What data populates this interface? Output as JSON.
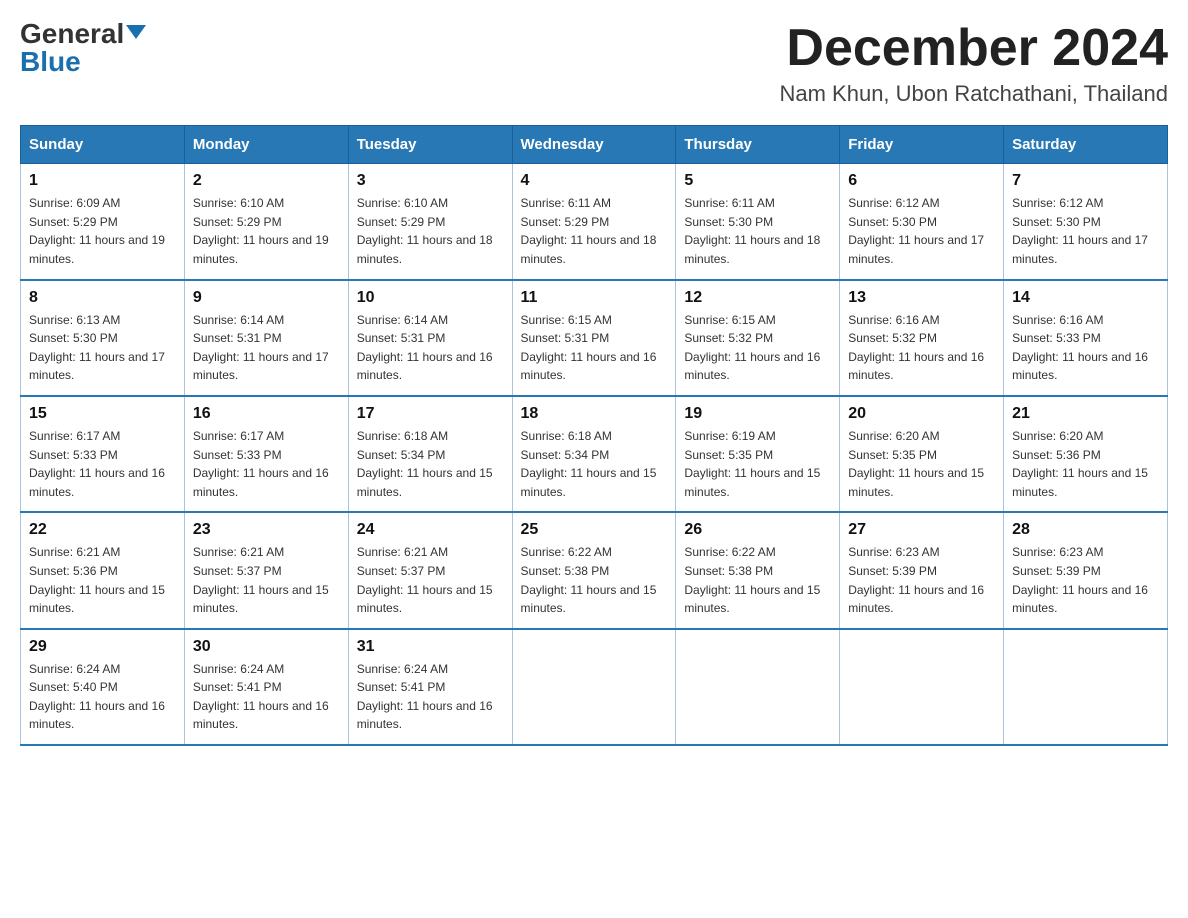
{
  "logo": {
    "general": "General",
    "blue": "Blue",
    "triangle": true
  },
  "title": "December 2024",
  "subtitle": "Nam Khun, Ubon Ratchathani, Thailand",
  "days_of_week": [
    "Sunday",
    "Monday",
    "Tuesday",
    "Wednesday",
    "Thursday",
    "Friday",
    "Saturday"
  ],
  "weeks": [
    [
      {
        "day": "1",
        "sunrise": "6:09 AM",
        "sunset": "5:29 PM",
        "daylight": "11 hours and 19 minutes."
      },
      {
        "day": "2",
        "sunrise": "6:10 AM",
        "sunset": "5:29 PM",
        "daylight": "11 hours and 19 minutes."
      },
      {
        "day": "3",
        "sunrise": "6:10 AM",
        "sunset": "5:29 PM",
        "daylight": "11 hours and 18 minutes."
      },
      {
        "day": "4",
        "sunrise": "6:11 AM",
        "sunset": "5:29 PM",
        "daylight": "11 hours and 18 minutes."
      },
      {
        "day": "5",
        "sunrise": "6:11 AM",
        "sunset": "5:30 PM",
        "daylight": "11 hours and 18 minutes."
      },
      {
        "day": "6",
        "sunrise": "6:12 AM",
        "sunset": "5:30 PM",
        "daylight": "11 hours and 17 minutes."
      },
      {
        "day": "7",
        "sunrise": "6:12 AM",
        "sunset": "5:30 PM",
        "daylight": "11 hours and 17 minutes."
      }
    ],
    [
      {
        "day": "8",
        "sunrise": "6:13 AM",
        "sunset": "5:30 PM",
        "daylight": "11 hours and 17 minutes."
      },
      {
        "day": "9",
        "sunrise": "6:14 AM",
        "sunset": "5:31 PM",
        "daylight": "11 hours and 17 minutes."
      },
      {
        "day": "10",
        "sunrise": "6:14 AM",
        "sunset": "5:31 PM",
        "daylight": "11 hours and 16 minutes."
      },
      {
        "day": "11",
        "sunrise": "6:15 AM",
        "sunset": "5:31 PM",
        "daylight": "11 hours and 16 minutes."
      },
      {
        "day": "12",
        "sunrise": "6:15 AM",
        "sunset": "5:32 PM",
        "daylight": "11 hours and 16 minutes."
      },
      {
        "day": "13",
        "sunrise": "6:16 AM",
        "sunset": "5:32 PM",
        "daylight": "11 hours and 16 minutes."
      },
      {
        "day": "14",
        "sunrise": "6:16 AM",
        "sunset": "5:33 PM",
        "daylight": "11 hours and 16 minutes."
      }
    ],
    [
      {
        "day": "15",
        "sunrise": "6:17 AM",
        "sunset": "5:33 PM",
        "daylight": "11 hours and 16 minutes."
      },
      {
        "day": "16",
        "sunrise": "6:17 AM",
        "sunset": "5:33 PM",
        "daylight": "11 hours and 16 minutes."
      },
      {
        "day": "17",
        "sunrise": "6:18 AM",
        "sunset": "5:34 PM",
        "daylight": "11 hours and 15 minutes."
      },
      {
        "day": "18",
        "sunrise": "6:18 AM",
        "sunset": "5:34 PM",
        "daylight": "11 hours and 15 minutes."
      },
      {
        "day": "19",
        "sunrise": "6:19 AM",
        "sunset": "5:35 PM",
        "daylight": "11 hours and 15 minutes."
      },
      {
        "day": "20",
        "sunrise": "6:20 AM",
        "sunset": "5:35 PM",
        "daylight": "11 hours and 15 minutes."
      },
      {
        "day": "21",
        "sunrise": "6:20 AM",
        "sunset": "5:36 PM",
        "daylight": "11 hours and 15 minutes."
      }
    ],
    [
      {
        "day": "22",
        "sunrise": "6:21 AM",
        "sunset": "5:36 PM",
        "daylight": "11 hours and 15 minutes."
      },
      {
        "day": "23",
        "sunrise": "6:21 AM",
        "sunset": "5:37 PM",
        "daylight": "11 hours and 15 minutes."
      },
      {
        "day": "24",
        "sunrise": "6:21 AM",
        "sunset": "5:37 PM",
        "daylight": "11 hours and 15 minutes."
      },
      {
        "day": "25",
        "sunrise": "6:22 AM",
        "sunset": "5:38 PM",
        "daylight": "11 hours and 15 minutes."
      },
      {
        "day": "26",
        "sunrise": "6:22 AM",
        "sunset": "5:38 PM",
        "daylight": "11 hours and 15 minutes."
      },
      {
        "day": "27",
        "sunrise": "6:23 AM",
        "sunset": "5:39 PM",
        "daylight": "11 hours and 16 minutes."
      },
      {
        "day": "28",
        "sunrise": "6:23 AM",
        "sunset": "5:39 PM",
        "daylight": "11 hours and 16 minutes."
      }
    ],
    [
      {
        "day": "29",
        "sunrise": "6:24 AM",
        "sunset": "5:40 PM",
        "daylight": "11 hours and 16 minutes."
      },
      {
        "day": "30",
        "sunrise": "6:24 AM",
        "sunset": "5:41 PM",
        "daylight": "11 hours and 16 minutes."
      },
      {
        "day": "31",
        "sunrise": "6:24 AM",
        "sunset": "5:41 PM",
        "daylight": "11 hours and 16 minutes."
      },
      null,
      null,
      null,
      null
    ]
  ]
}
